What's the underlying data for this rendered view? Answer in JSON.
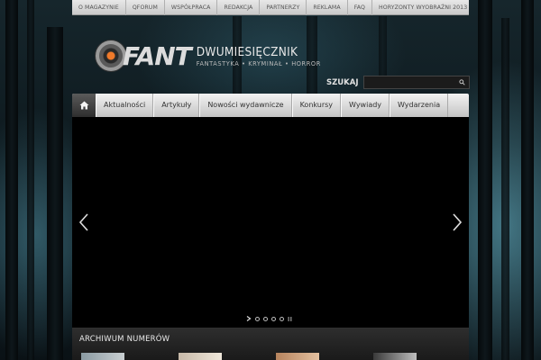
{
  "top_nav": {
    "items": [
      "O MAGAZYNIE",
      "QFORUM",
      "WSPÓŁPRACA",
      "REDAKCJA",
      "PARTNERZY",
      "REKLAMA",
      "FAQ",
      "HORYZONTY WYOBRAŹNI 2013"
    ]
  },
  "logo": {
    "word": "FANT",
    "line1": "DWUMIESIĘCZNIK",
    "line2": "FANTASTYKA • KRYMINAŁ • HORROR"
  },
  "search": {
    "label": "SZUKAJ",
    "value": "",
    "icon": "search-icon"
  },
  "main_nav": {
    "home_icon": "home-icon",
    "items": [
      "Aktualności",
      "Artykuły",
      "Nowości wydawnicze",
      "Konkursy",
      "Wywiady",
      "Wydarzenia"
    ]
  },
  "slider": {
    "slide_count": 4,
    "icons": [
      "chevron-left-icon",
      "chevron-right-icon",
      "play-icon",
      "pause-icon"
    ]
  },
  "archive": {
    "title": "ARCHIWUM NUMERÓW"
  },
  "colors": {
    "accent": "#f07a2a",
    "nav_bg": "#d8d8d8",
    "slider_bg": "#000000"
  }
}
